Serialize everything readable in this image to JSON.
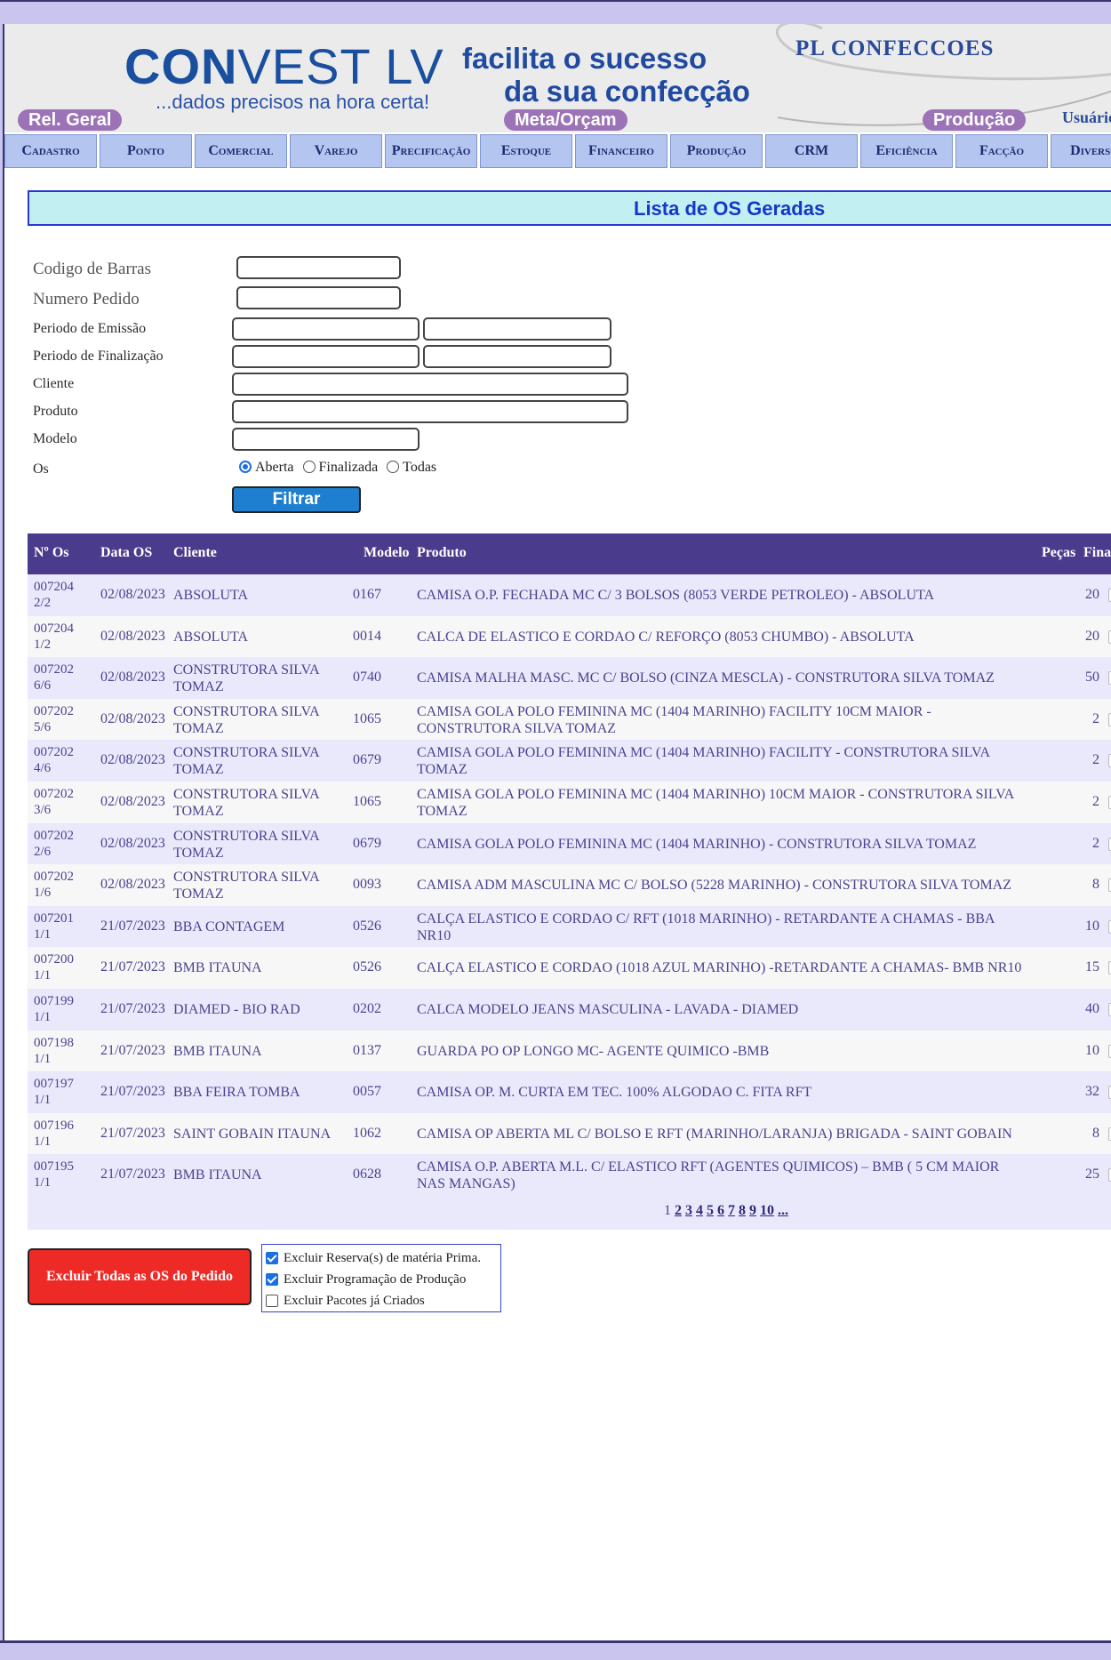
{
  "header": {
    "logo_bold": "CON",
    "logo_rest": "VEST LV",
    "slogan": "...dados precisos na hora certa!",
    "tagline_1": "facilita o sucesso",
    "tagline_2": "da sua confecção",
    "company": "PL CONFECCOES",
    "pill_rel": "Rel. Geral",
    "pill_meta": "Meta/Orçam",
    "pill_prod": "Produção",
    "usuario": "Usuário"
  },
  "menu": [
    "Cadastro",
    "Ponto",
    "Comercial",
    "Varejo",
    "Precificação",
    "Estoque",
    "Financeiro",
    "Produção",
    "CRM",
    "Eficiência",
    "Facção",
    "Diversos"
  ],
  "page_title": "Lista de OS Geradas",
  "form": {
    "codigo_barras": "Codigo de Barras",
    "numero_pedido": "Numero Pedido",
    "periodo_emissao": "Periodo de Emissão",
    "periodo_finalizacao": "Periodo de Finalização",
    "cliente": "Cliente",
    "produto": "Produto",
    "modelo": "Modelo",
    "os": "Os",
    "radio_aberta": "Aberta",
    "radio_finalizada": "Finalizada",
    "radio_todas": "Todas",
    "filtrar": "Filtrar"
  },
  "table": {
    "headers": {
      "os": "Nº Os",
      "data": "Data OS",
      "cliente": "Cliente",
      "modelo": "Modelo",
      "produto": "Produto",
      "pecas": "Peças",
      "final": "Final"
    },
    "rows": [
      {
        "os1": "007204",
        "os2": "2/2",
        "data": "02/08/2023",
        "cli1": "ABSOLUTA",
        "cli2": "",
        "modelo": "0167",
        "prod1": "CAMISA O.P. FECHADA MC C/ 3 BOLSOS (8053 VERDE PETROLEO) - ABSOLUTA",
        "prod2": "",
        "pecas": "20"
      },
      {
        "os1": "007204",
        "os2": "1/2",
        "data": "02/08/2023",
        "cli1": "ABSOLUTA",
        "cli2": "",
        "modelo": "0014",
        "prod1": "CALCA DE ELASTICO E CORDAO C/ REFORÇO (8053 CHUMBO) - ABSOLUTA",
        "prod2": "",
        "pecas": "20"
      },
      {
        "os1": "007202",
        "os2": "6/6",
        "data": "02/08/2023",
        "cli1": "CONSTRUTORA SILVA",
        "cli2": "TOMAZ",
        "modelo": "0740",
        "prod1": "CAMISA MALHA MASC. MC C/ BOLSO (CINZA MESCLA) - CONSTRUTORA SILVA TOMAZ",
        "prod2": "",
        "pecas": "50"
      },
      {
        "os1": "007202",
        "os2": "5/6",
        "data": "02/08/2023",
        "cli1": "CONSTRUTORA SILVA",
        "cli2": "TOMAZ",
        "modelo": "1065",
        "prod1": "CAMISA GOLA POLO FEMININA MC (1404 MARINHO) FACILITY 10CM MAIOR -",
        "prod2": "CONSTRUTORA SILVA TOMAZ",
        "pecas": "2"
      },
      {
        "os1": "007202",
        "os2": "4/6",
        "data": "02/08/2023",
        "cli1": "CONSTRUTORA SILVA",
        "cli2": "TOMAZ",
        "modelo": "0679",
        "prod1": "CAMISA GOLA POLO FEMININA MC (1404 MARINHO) FACILITY - CONSTRUTORA SILVA",
        "prod2": "TOMAZ",
        "pecas": "2"
      },
      {
        "os1": "007202",
        "os2": "3/6",
        "data": "02/08/2023",
        "cli1": "CONSTRUTORA SILVA",
        "cli2": "TOMAZ",
        "modelo": "1065",
        "prod1": "CAMISA GOLA POLO FEMININA MC (1404 MARINHO) 10CM MAIOR - CONSTRUTORA SILVA",
        "prod2": "TOMAZ",
        "pecas": "2"
      },
      {
        "os1": "007202",
        "os2": "2/6",
        "data": "02/08/2023",
        "cli1": "CONSTRUTORA SILVA",
        "cli2": "TOMAZ",
        "modelo": "0679",
        "prod1": "CAMISA GOLA POLO FEMININA MC (1404 MARINHO) - CONSTRUTORA SILVA TOMAZ",
        "prod2": "",
        "pecas": "2"
      },
      {
        "os1": "007202",
        "os2": "1/6",
        "data": "02/08/2023",
        "cli1": "CONSTRUTORA SILVA",
        "cli2": "TOMAZ",
        "modelo": "0093",
        "prod1": "CAMISA ADM MASCULINA MC C/ BOLSO (5228 MARINHO) - CONSTRUTORA SILVA TOMAZ",
        "prod2": "",
        "pecas": "8"
      },
      {
        "os1": "007201",
        "os2": "1/1",
        "data": "21/07/2023",
        "cli1": "BBA CONTAGEM",
        "cli2": "",
        "modelo": "0526",
        "prod1": "CALÇA ELASTICO E CORDAO C/ RFT (1018 MARINHO) - RETARDANTE A CHAMAS - BBA",
        "prod2": "NR10",
        "pecas": "10"
      },
      {
        "os1": "007200",
        "os2": "1/1",
        "data": "21/07/2023",
        "cli1": "BMB ITAUNA",
        "cli2": "",
        "modelo": "0526",
        "prod1": "CALÇA ELASTICO E CORDAO (1018 AZUL MARINHO) -RETARDANTE A CHAMAS- BMB NR10",
        "prod2": "",
        "pecas": "15"
      },
      {
        "os1": "007199",
        "os2": "1/1",
        "data": "21/07/2023",
        "cli1": "DIAMED - BIO RAD",
        "cli2": "",
        "modelo": "0202",
        "prod1": "CALCA MODELO JEANS MASCULINA - LAVADA - DIAMED",
        "prod2": "",
        "pecas": "40"
      },
      {
        "os1": "007198",
        "os2": "1/1",
        "data": "21/07/2023",
        "cli1": "BMB ITAUNA",
        "cli2": "",
        "modelo": "0137",
        "prod1": "GUARDA PO OP LONGO MC- AGENTE QUIMICO -BMB",
        "prod2": "",
        "pecas": "10"
      },
      {
        "os1": "007197",
        "os2": "1/1",
        "data": "21/07/2023",
        "cli1": "BBA FEIRA TOMBA",
        "cli2": "",
        "modelo": "0057",
        "prod1": "CAMISA OP. M. CURTA EM TEC. 100% ALGODAO C. FITA RFT",
        "prod2": "",
        "pecas": "32"
      },
      {
        "os1": "007196",
        "os2": "1/1",
        "data": "21/07/2023",
        "cli1": "SAINT GOBAIN ITAUNA",
        "cli2": "",
        "modelo": "1062",
        "prod1": "CAMISA OP ABERTA ML C/ BOLSO E RFT (MARINHO/LARANJA) BRIGADA - SAINT GOBAIN",
        "prod2": "",
        "pecas": "8"
      },
      {
        "os1": "007195",
        "os2": "1/1",
        "data": "21/07/2023",
        "cli1": "BMB ITAUNA",
        "cli2": "",
        "modelo": "0628",
        "prod1": "CAMISA O.P. ABERTA M.L. C/ ELASTICO RFT (AGENTES QUIMICOS) – BMB ( 5 CM MAIOR",
        "prod2": "NAS MANGAS)",
        "pecas": "25"
      }
    ],
    "pager": {
      "current": "1",
      "pages": [
        "2",
        "3",
        "4",
        "5",
        "6",
        "7",
        "8",
        "9",
        "10",
        "..."
      ]
    }
  },
  "delete": {
    "button": "Excluir Todas as OS do Pedido",
    "opt1": "Excluir Reserva(s) de matéria Prima.",
    "opt2": "Excluir Programação de Produção",
    "opt3": "Excluir Pacotes já Criados"
  },
  "colors": {
    "header_bg": "#4a3b8c",
    "accent": "#1437c9",
    "danger": "#ee2a27",
    "filtrar": "#1e7fd0"
  }
}
